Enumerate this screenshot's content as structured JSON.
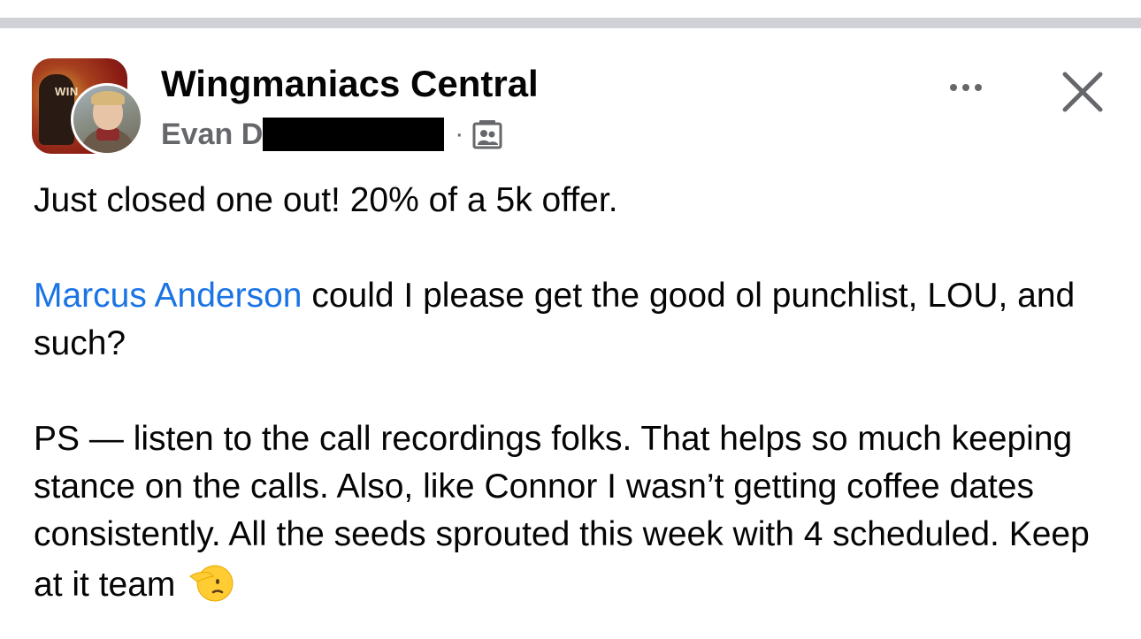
{
  "post": {
    "group_name": "Wingmaniacs Central",
    "group_logo_text": "WIN",
    "author_visible_name": "Evan D",
    "meta_separator": "·",
    "icons": {
      "more": "more-horizontal-icon",
      "close": "close-icon",
      "audience": "group-members-icon",
      "emoji": "saluting-face-emoji"
    },
    "paragraph_1": "Just closed one out! 20% of a 5k offer.",
    "mention": "Marcus Anderson",
    "paragraph_2_rest": " could I please get the good ol punchlist, LOU, and such?",
    "paragraph_3": "PS — listen to the call recordings folks. That helps so much keeping stance on the calls. Also, like Connor I wasn’t getting coffee dates consistently. All the seeds sprouted this week with 4 scheduled. Keep at it team",
    "colors": {
      "mention": "#1b74e4",
      "secondary_text": "#65676b",
      "divider": "#cfd1d6"
    }
  }
}
